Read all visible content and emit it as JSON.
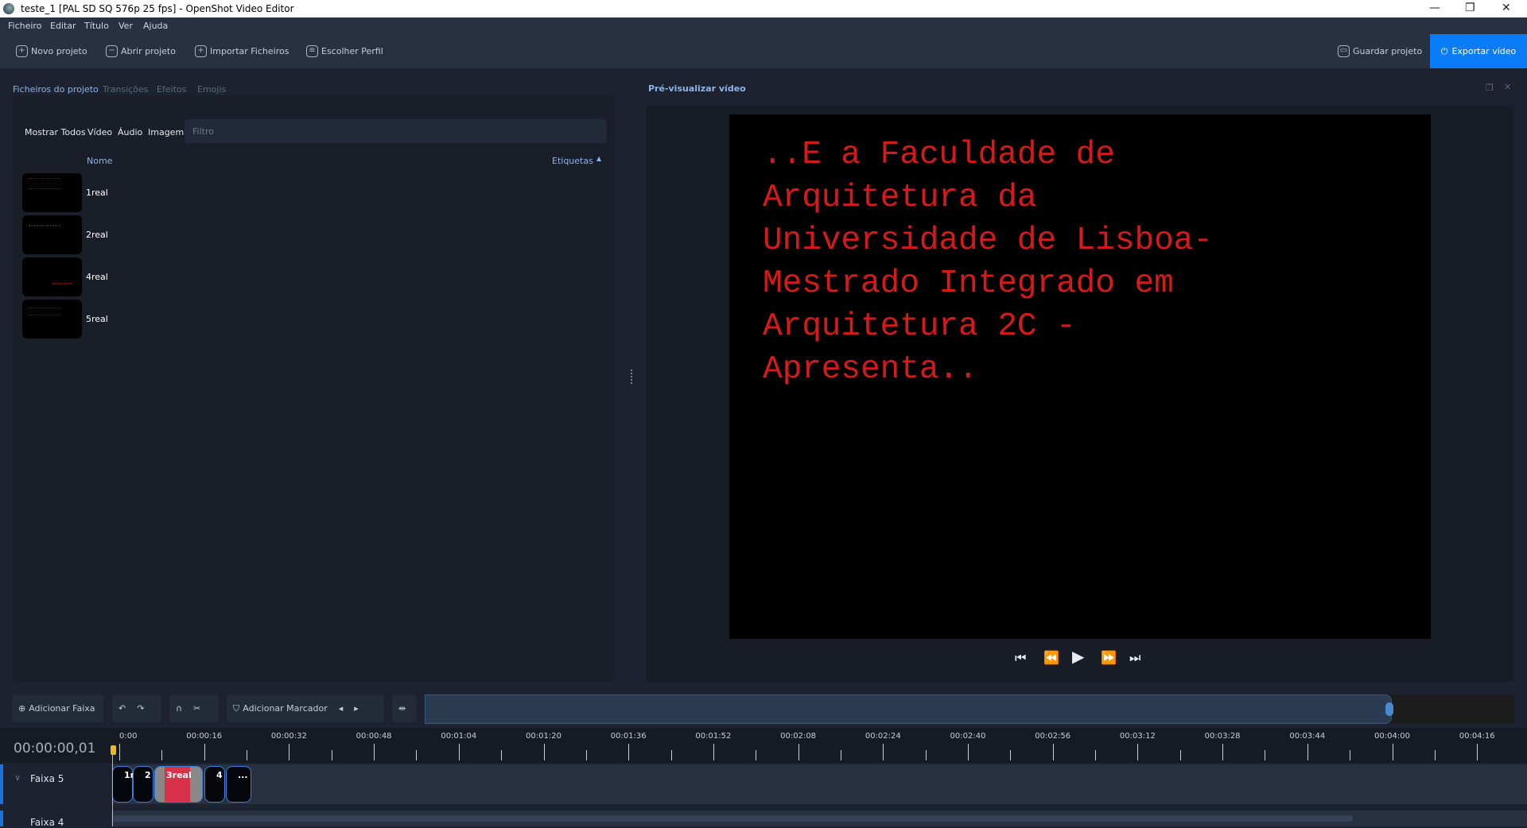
{
  "window": {
    "title": "teste_1 [PAL SD SQ 576p 25 fps] - OpenShot Video Editor",
    "minimize": "—",
    "restore": "❐",
    "close": "✕"
  },
  "menu": [
    "Ficheiro",
    "Editar",
    "Título",
    "Ver",
    "Ajuda"
  ],
  "toolbar": {
    "new": "Novo projeto",
    "open": "Abrir projeto",
    "import": "Importar Ficheiros",
    "profile": "Escolher Perfil",
    "save": "Guardar projeto",
    "export": "Exportar vídeo"
  },
  "left_tabs": [
    "Ficheiros do projeto",
    "Transições",
    "Efeitos",
    "Emojis"
  ],
  "filters": [
    "Mostrar Todos",
    "Vídeo",
    "Áudio",
    "Imagem"
  ],
  "filter_placeholder": "Filtro",
  "columns": {
    "name": "Nome",
    "tags": "Etiquetas"
  },
  "files": [
    {
      "name": "1real"
    },
    {
      "name": "2real"
    },
    {
      "name": "4real"
    },
    {
      "name": "5real"
    }
  ],
  "preview": {
    "title": "Pré-visualizar vídeo",
    "lines": [
      "..E a Faculdade de",
      "Arquitetura da",
      "Universidade de Lisboa-",
      "Mestrado Integrado em",
      "Arquitetura 2C -",
      "Apresenta.."
    ]
  },
  "timeline": {
    "add_track": "Adicionar Faixa",
    "add_marker": "Adicionar Marcador",
    "timecode": "00:00:00,01",
    "ruler": [
      "0:00",
      "00:00:16",
      "00:00:32",
      "00:00:48",
      "00:01:04",
      "00:01:20",
      "00:01:36",
      "00:01:52",
      "00:02:08",
      "00:02:24",
      "00:02:40",
      "00:02:56",
      "00:03:12",
      "00:03:28",
      "00:03:44",
      "00:04:00",
      "00:04:16"
    ],
    "tracks": [
      "Faixa 5",
      "Faixa 4"
    ],
    "clips": [
      "1r",
      "2",
      "3real",
      "4",
      "..."
    ]
  }
}
